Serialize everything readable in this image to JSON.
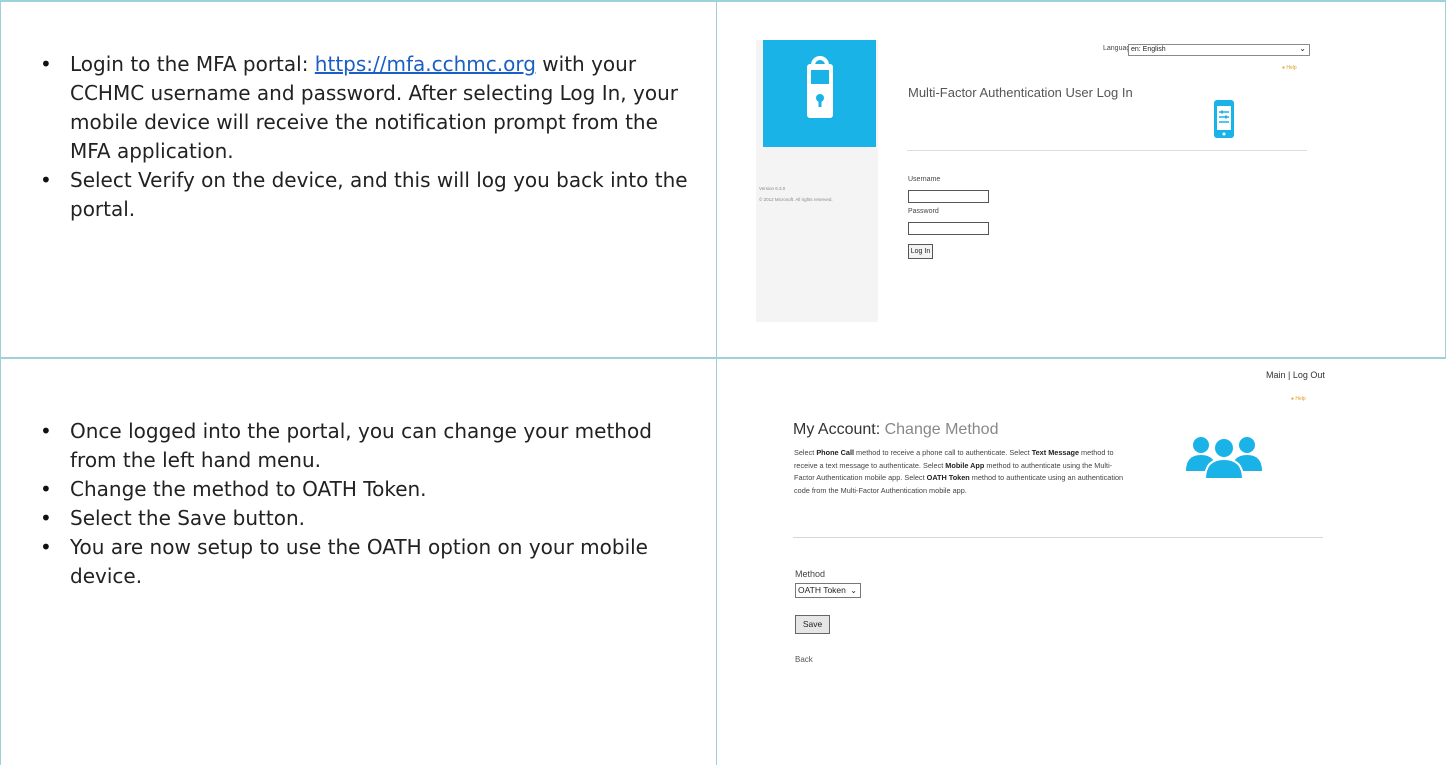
{
  "section1": {
    "bullets": [
      {
        "before": "Login to the MFA portal:  ",
        "link": "https://mfa.cchmc.org",
        "after": " with your CCHMC username and password.  After selecting Log In, your mobile device will receive the notification prompt from the MFA application."
      },
      {
        "text": "Select Verify on the device, and this will log you back into the portal."
      }
    ],
    "screenshot": {
      "language_label": "Language",
      "language_value": "en: English",
      "help_label": "Help",
      "title": "Multi-Factor Authentication User Log In",
      "version_text": "Version 6.3.0",
      "copyright_text": "© 2012 Microsoft. All rights reserved.",
      "username_label": "Username",
      "password_label": "Password",
      "login_button": "Log In",
      "tile_color": "#1ab3e8"
    }
  },
  "section2": {
    "bullets": [
      "Once logged into the portal, you can change your method from the left hand menu.",
      "Change the method to OATH Token.",
      "Select the Save button.",
      "You are now setup to use the OATH option on your mobile device."
    ],
    "screenshot": {
      "top_links": "Main | Log Out",
      "help_label": "Help",
      "title_main": "My Account:",
      "title_sub": " Change Method",
      "desc": [
        {
          "t": "Select "
        },
        {
          "b": "Phone Call"
        },
        {
          "t": " method to receive a phone call to authenticate. Select "
        },
        {
          "b": "Text Message"
        },
        {
          "t": " method to receive a text message to authenticate. Select "
        },
        {
          "b": "Mobile App"
        },
        {
          "t": " method to authenticate using the Multi-Factor Authentication mobile app. Select "
        },
        {
          "b": "OATH Token"
        },
        {
          "t": " method to authenticate using an authentication code from the Multi-Factor Authentication mobile app."
        }
      ],
      "method_label": "Method",
      "method_value": "OATH Token",
      "save_button": "Save",
      "back_link": "Back",
      "icon_color": "#1ab3e8"
    }
  }
}
